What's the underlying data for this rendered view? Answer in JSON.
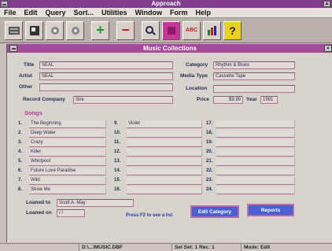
{
  "app": {
    "title": "Approach"
  },
  "menu": [
    {
      "label": "File"
    },
    {
      "label": "Edit"
    },
    {
      "label": "Query"
    },
    {
      "label": "Sort..."
    },
    {
      "label": "Utilities"
    },
    {
      "label": "Window"
    },
    {
      "label": "Form"
    },
    {
      "label": "Help"
    }
  ],
  "toolbar": {
    "buttons": [
      {
        "icon": "database-icon"
      },
      {
        "icon": "form-icon"
      },
      {
        "icon": "prev-record-icon"
      },
      {
        "icon": "next-record-icon"
      },
      {
        "icon": "add-record-icon",
        "glyph": "+"
      },
      {
        "icon": "delete-record-icon",
        "glyph": "−"
      },
      {
        "icon": "find-icon"
      },
      {
        "icon": "sort-icon"
      },
      {
        "icon": "spell-icon",
        "glyph": "ABC"
      },
      {
        "icon": "chart-icon"
      },
      {
        "icon": "help-icon",
        "glyph": "?"
      }
    ]
  },
  "window": {
    "title": "Music Collections"
  },
  "form": {
    "labels": {
      "title": "Title",
      "artist": "Artist",
      "other": "Other",
      "record_company": "Record Company",
      "category": "Category",
      "media_type": "Media Type",
      "location": "Location",
      "price": "Price",
      "year": "Year",
      "songs": "Songs",
      "loaned_to": "Loaned to",
      "loaned_on": "Loaned on"
    },
    "values": {
      "title": "SEAL",
      "artist": "SEAL",
      "other": "",
      "record_company": "Sire",
      "category": "Rhythm & Blues",
      "media_type": "Cassette Tape",
      "location": "",
      "price": "$9.99",
      "year": "1991",
      "loaned_to": "Scott A. May",
      "loaned_on": "/ /"
    },
    "songs": [
      {
        "num": "1.",
        "title": "The Beginning"
      },
      {
        "num": "2.",
        "title": "Deep Water"
      },
      {
        "num": "3.",
        "title": "Crazy"
      },
      {
        "num": "4.",
        "title": "Killer"
      },
      {
        "num": "5.",
        "title": "Whirlpool"
      },
      {
        "num": "6.",
        "title": "Future Love Paradise"
      },
      {
        "num": "7.",
        "title": "Wild"
      },
      {
        "num": "8.",
        "title": "Show Me"
      },
      {
        "num": "9.",
        "title": "Violet"
      },
      {
        "num": "10.",
        "title": ""
      },
      {
        "num": "11.",
        "title": ""
      },
      {
        "num": "12.",
        "title": ""
      },
      {
        "num": "13.",
        "title": ""
      },
      {
        "num": "14.",
        "title": ""
      },
      {
        "num": "15.",
        "title": ""
      },
      {
        "num": "16.",
        "title": ""
      },
      {
        "num": "17.",
        "title": ""
      },
      {
        "num": "18.",
        "title": ""
      },
      {
        "num": "19.",
        "title": ""
      },
      {
        "num": "20.",
        "title": ""
      },
      {
        "num": "21.",
        "title": ""
      },
      {
        "num": "22.",
        "title": ""
      },
      {
        "num": "23.",
        "title": ""
      },
      {
        "num": "24.",
        "title": ""
      }
    ],
    "hint": "Press F2 to see a list",
    "edit_category_label": "Edit Category",
    "reports_label": "Reports"
  },
  "status": {
    "file": "D:\\...\\MUSIC.DBF",
    "selection": "Sel Set: 1  Rec: 1",
    "mode": "Mode: Edit"
  },
  "colors": {
    "app_titlebar": "#7e3e88",
    "window_titlebar": "#a14b9a",
    "label_text": "#1e2a56",
    "section_heading": "#b23a8e",
    "button_bg": "#4a5fd0"
  }
}
